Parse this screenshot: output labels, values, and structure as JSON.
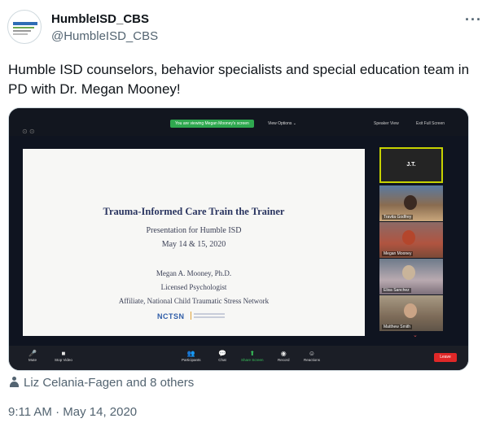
{
  "author": {
    "display_name": "HumbleISD_CBS",
    "handle": "@HumbleISD_CBS",
    "avatar_icon": "district-logo-icon",
    "more_icon": "more-options-icon"
  },
  "tweet": {
    "text": "Humble ISD counselors, behavior specialists and special education team in PD with Dr. Megan Mooney!"
  },
  "zoom": {
    "viewing_banner": "You are viewing Megan Mooney's screen",
    "view_options": "View Options ⌄",
    "speaker_view": "Speaker View",
    "exit_full_screen": "Exit Full Screen",
    "slide": {
      "title": "Trauma-Informed Care Train the Trainer",
      "subtitle": "Presentation for Humble ISD",
      "dates": "May 14 & 15, 2020",
      "presenter": "Megan A. Mooney, Ph.D.",
      "role": "Licensed Psychologist",
      "affiliation": "Affiliate, National Child Traumatic Stress Network",
      "logo_text": "NCTSN"
    },
    "participants": [
      {
        "label": "J.T."
      },
      {
        "label": "Travita Godfrey"
      },
      {
        "label": "Megan Mooney"
      },
      {
        "label": "Elisa Sanchez"
      },
      {
        "label": "Matthew Smith"
      }
    ],
    "toolbar": [
      {
        "icon": "microphone-icon",
        "glyph": "🎤",
        "label": "Mute"
      },
      {
        "icon": "video-camera-icon",
        "glyph": "■",
        "label": "Stop Video"
      },
      {
        "icon": "participants-icon",
        "glyph": "👥",
        "label": "Participants"
      },
      {
        "icon": "chat-icon",
        "glyph": "💬",
        "label": "Chat"
      },
      {
        "icon": "share-screen-icon",
        "glyph": "⬆",
        "label": "Share Screen"
      },
      {
        "icon": "record-icon",
        "glyph": "◉",
        "label": "Record"
      },
      {
        "icon": "reactions-icon",
        "glyph": "☺",
        "label": "Reactions"
      }
    ],
    "leave_label": "Leave",
    "accent_green": "#38c25a",
    "leave_red": "#e02828"
  },
  "engagement": {
    "liked_by": "Liz Celania-Fagen and 8 others"
  },
  "meta": {
    "timestamp": "9:11 AM · May 14, 2020"
  }
}
